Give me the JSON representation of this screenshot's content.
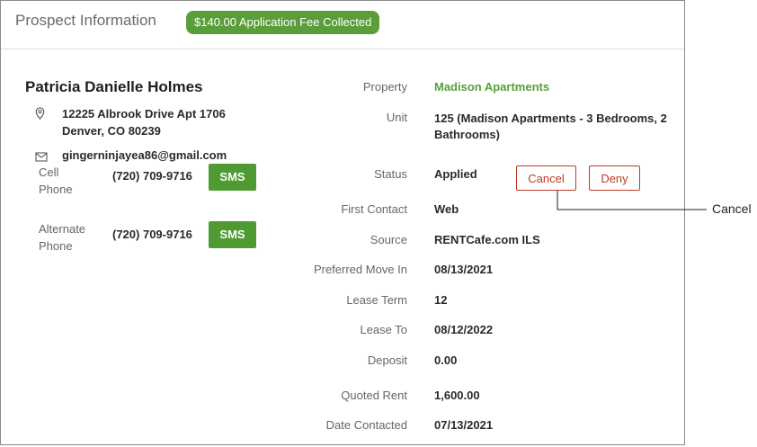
{
  "header": {
    "title": "Prospect Information",
    "fee_badge": "$140.00 Application Fee Collected"
  },
  "prospect": {
    "name": "Patricia Danielle Holmes",
    "address_line1": "12225 Albrook Drive Apt 1706",
    "address_line2": "Denver, CO 80239",
    "email": "gingerninjayea86@gmail.com",
    "phones": [
      {
        "label_line1": "Cell",
        "label_line2": "Phone",
        "number": "(720) 709-9716",
        "action": "SMS"
      },
      {
        "label_line1": "Alternate",
        "label_line2": "Phone",
        "number": "(720) 709-9716",
        "action": "SMS"
      }
    ],
    "icons": {
      "address": "map-pin-icon",
      "email": "envelope-icon"
    }
  },
  "details": {
    "property_label": "Property",
    "property_value": "Madison Apartments",
    "unit_label": "Unit",
    "unit_value_line1": "125 (Madison Apartments - 3 Bedrooms, 2",
    "unit_value_line2": "Bathrooms)",
    "status_label": "Status",
    "status_value": "Applied",
    "cancel_label": "Cancel",
    "deny_label": "Deny",
    "first_contact_label": "First Contact",
    "first_contact_value": "Web",
    "source_label": "Source",
    "source_value": "RENTCafe.com ILS",
    "move_in_label": "Preferred Move In",
    "move_in_value": "08/13/2021",
    "lease_term_label": "Lease Term",
    "lease_term_value": "12",
    "lease_to_label": "Lease To",
    "lease_to_value": "08/12/2022",
    "deposit_label": "Deposit",
    "deposit_value": "0.00",
    "quoted_rent_label": "Quoted Rent",
    "quoted_rent_value": "1,600.00",
    "date_contacted_label": "Date Contacted",
    "date_contacted_value": "07/13/2021"
  },
  "callout": {
    "text": "Cancel"
  },
  "colors": {
    "accent_green": "#5a9e3a",
    "danger_red": "#c0392b"
  }
}
